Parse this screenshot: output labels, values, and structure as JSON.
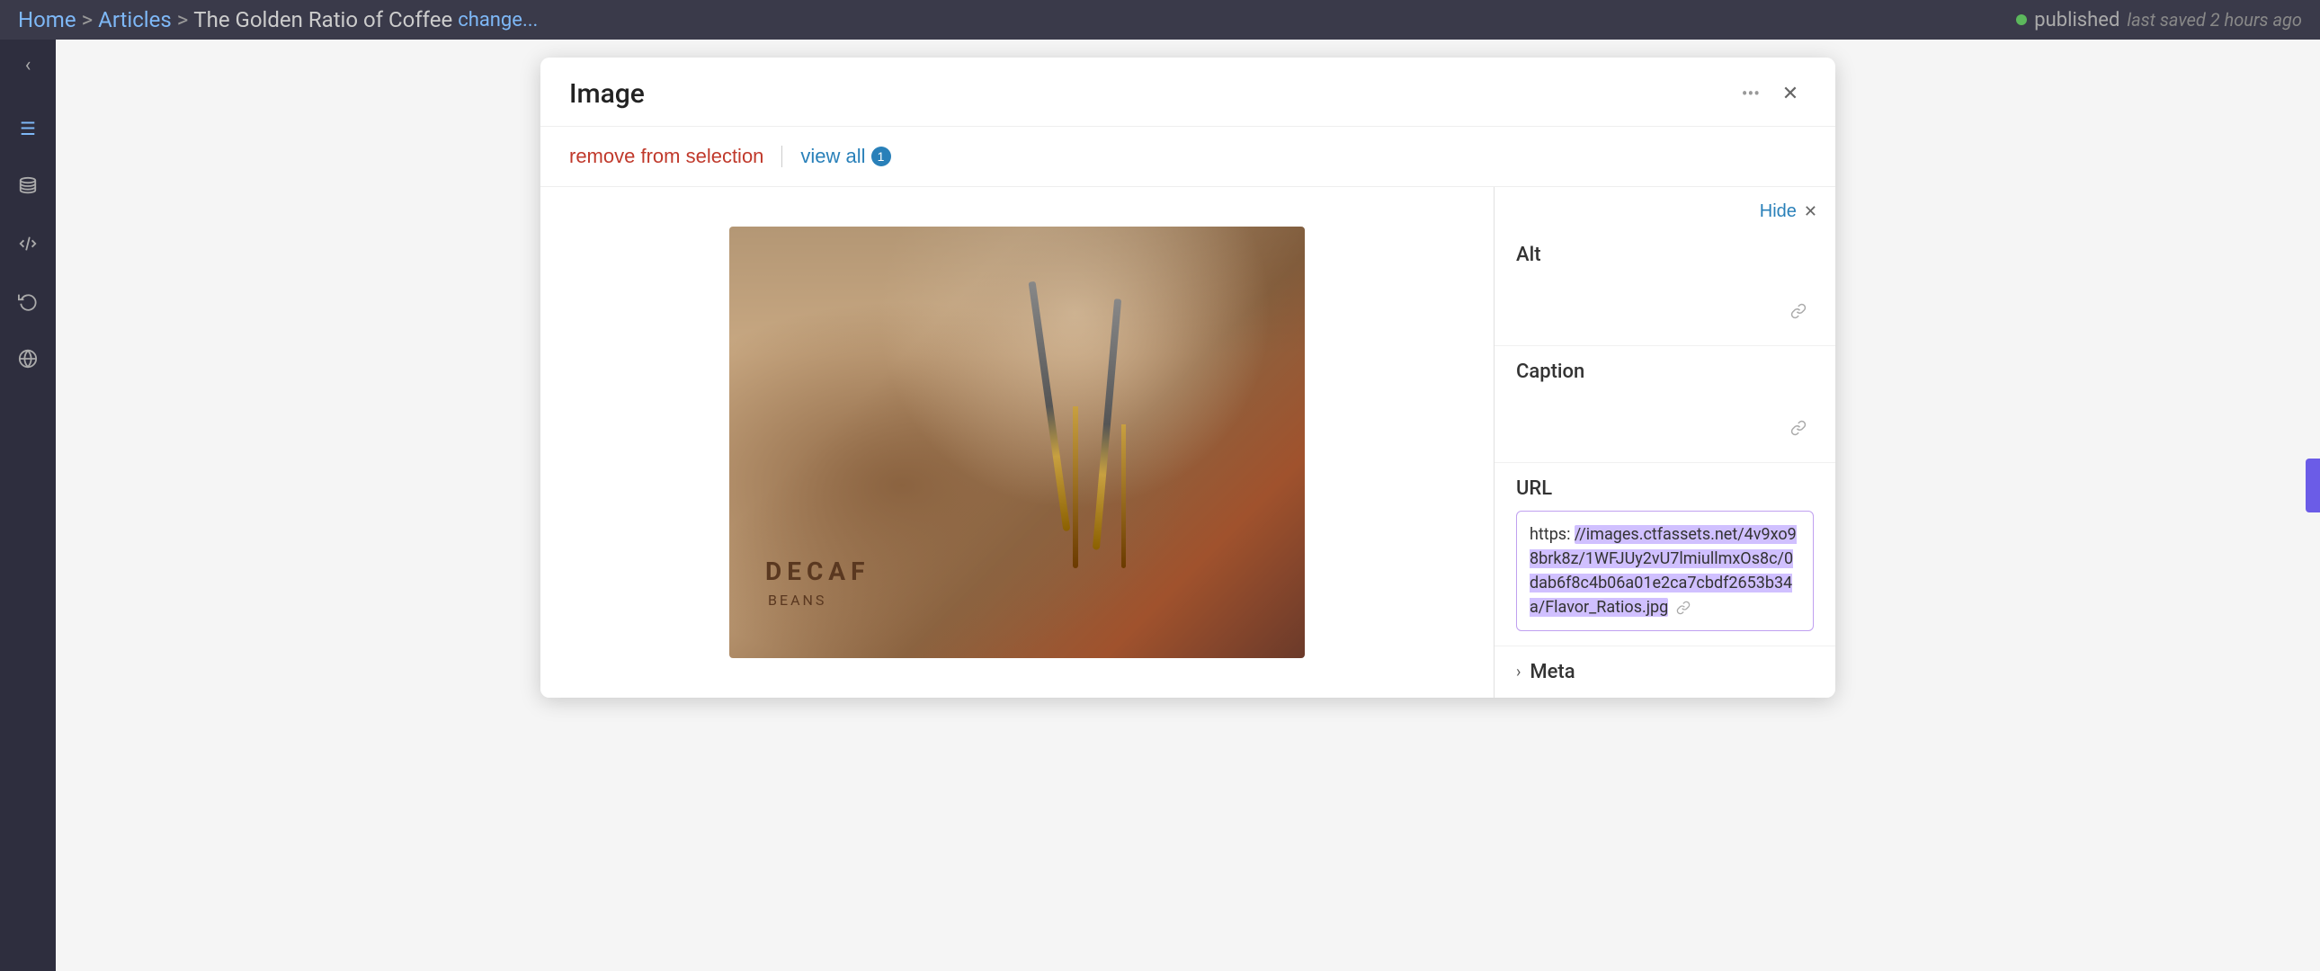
{
  "topbar": {
    "breadcrumb": {
      "home": "Home",
      "separator1": ">",
      "articles": "Articles",
      "separator2": ">",
      "page_title": "The Golden Ratio of Coffee",
      "change_link": "change..."
    },
    "status": {
      "dot_color": "#5cb85c",
      "label": "published",
      "saved_text": "last saved 2 hours ago"
    }
  },
  "sidebar": {
    "back_icon": "←",
    "icons": [
      {
        "name": "menu-icon",
        "symbol": "☰"
      },
      {
        "name": "database-icon",
        "symbol": "🗄"
      },
      {
        "name": "code-icon",
        "symbol": "{…}"
      },
      {
        "name": "history-icon",
        "symbol": "↺"
      },
      {
        "name": "globe-icon",
        "symbol": "🌐"
      }
    ]
  },
  "modal": {
    "title": "Image",
    "close_icon": "✕",
    "toolbar": {
      "remove_label": "remove from selection",
      "view_all_label": "view all",
      "view_all_count": "1"
    },
    "right_panel": {
      "hide_label": "Hide",
      "hide_x": "✕",
      "fields": {
        "alt": {
          "label": "Alt",
          "value": ""
        },
        "caption": {
          "label": "Caption",
          "value": ""
        },
        "url": {
          "label": "URL",
          "prefix": "https: ",
          "highlighted": "//images.ctfassets.net/4v9xo98brk8z/1WFJUy2vU7lmiullmxOs8c/0dab6f8c4b06a01e2ca7cbdf2653b34a/Flavor_Ratios.jpg",
          "full_url": "https://images.ctfassets.net/4v9xo98brk8z/1WFJUy2vU7lmiullmxOs8c/0dab6f8c4b06a01e2ca7cbdf2653b34a/Flavor_Ratios.jpg"
        }
      },
      "meta": {
        "label": "Meta",
        "chevron": "›"
      }
    },
    "image": {
      "decaf_text": "DECAF",
      "decaf_sub": "BEANS"
    }
  }
}
